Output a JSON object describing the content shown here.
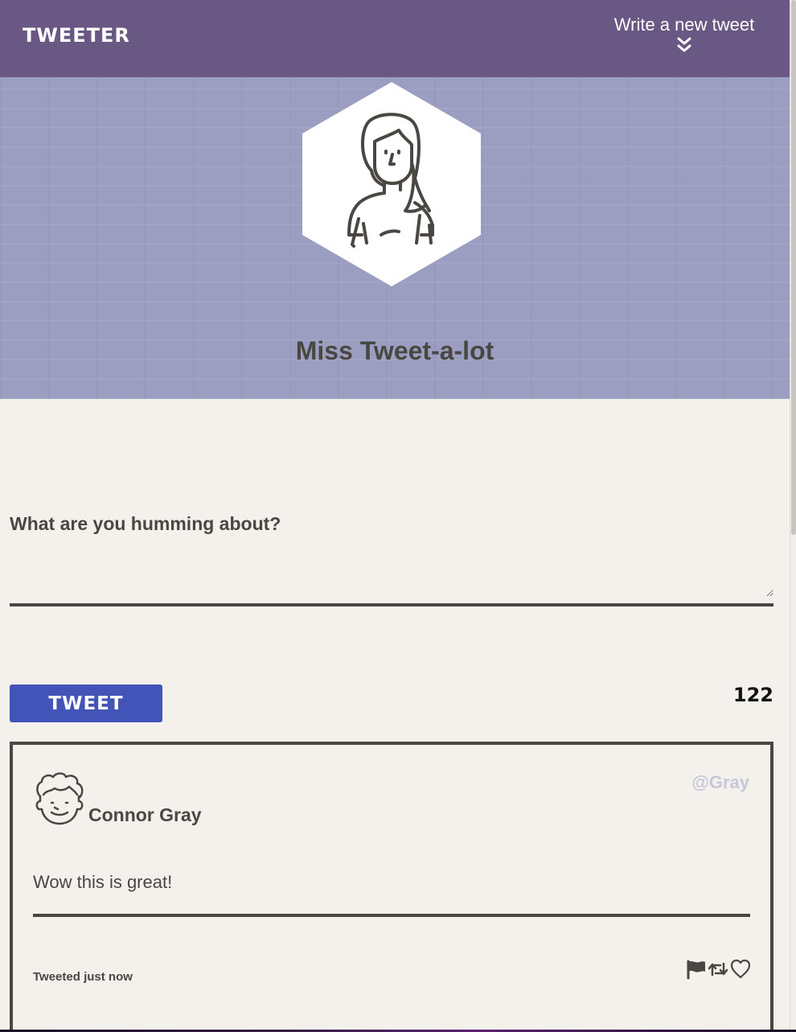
{
  "nav": {
    "brand": "TWEETER",
    "compose_label": "Write a new tweet",
    "compose_icon": "double-chevron-down-icon"
  },
  "profile": {
    "name": "Miss Tweet-a-lot",
    "avatar_icon": "woman-avatar-icon"
  },
  "composer": {
    "label": "What are you humming about?",
    "value": "",
    "placeholder": "",
    "button_label": "TWEET",
    "char_count": "122"
  },
  "tweets": [
    {
      "name": "Connor Gray",
      "handle": "@Gray",
      "body": "Wow this is great!",
      "timestamp": "Tweeted just now",
      "avatar_icon": "curly-hair-avatar-icon",
      "actions": [
        "flag-icon",
        "retweet-icon",
        "heart-icon"
      ]
    }
  ],
  "colors": {
    "nav_bg": "#685883",
    "hero_bg": "#9b9ec0",
    "page_bg": "#f4f1ec",
    "button_bg": "#4254b8",
    "handle_color": "#c6c7da",
    "text": "#4a4742"
  }
}
